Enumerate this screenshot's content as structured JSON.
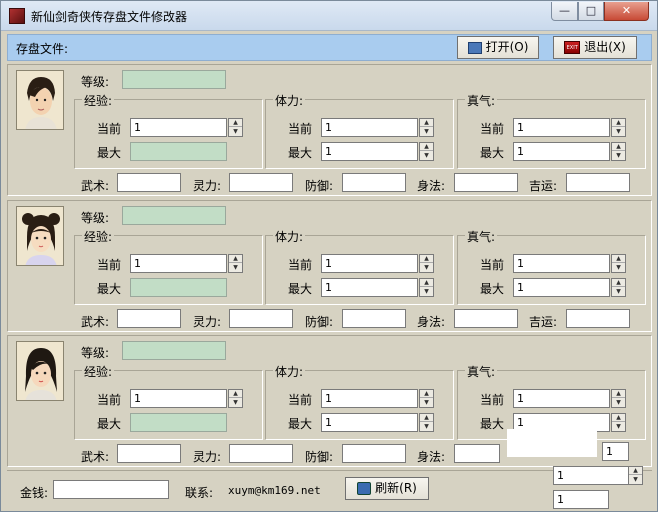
{
  "window": {
    "title": "新仙剑奇侠传存盘文件修改器",
    "controls": {
      "minimize": "—",
      "maximize": "□",
      "close": "✕"
    }
  },
  "savebar": {
    "label": "存盘文件:",
    "open_label": "打开(O)",
    "exit_label": "退出(X)",
    "exit_icon_text": "EXIT"
  },
  "labels": {
    "level": "等级:",
    "exp": "经验:",
    "hp": "体力:",
    "mp": "真气:",
    "current": "当前",
    "max": "最大",
    "wushu": "武术:",
    "lingli": "灵力:",
    "fangyu": "防御:",
    "shenfa": "身法:",
    "jiyun": "吉运:"
  },
  "characters": [
    {
      "name": "char-1",
      "level": "",
      "exp": {
        "current": "1",
        "max": ""
      },
      "hp": {
        "current": "1",
        "max": "1"
      },
      "mp": {
        "current": "1",
        "max": "1"
      },
      "stats": {
        "wushu": "",
        "lingli": "",
        "fangyu": "",
        "shenfa": "",
        "jiyun": ""
      }
    },
    {
      "name": "char-2",
      "level": "",
      "exp": {
        "current": "1",
        "max": ""
      },
      "hp": {
        "current": "1",
        "max": "1"
      },
      "mp": {
        "current": "1",
        "max": "1"
      },
      "stats": {
        "wushu": "",
        "lingli": "",
        "fangyu": "",
        "shenfa": "",
        "jiyun": ""
      }
    },
    {
      "name": "char-3",
      "level": "",
      "exp": {
        "current": "1",
        "max": ""
      },
      "hp": {
        "current": "1",
        "max": "1"
      },
      "mp": {
        "current": "1",
        "max": "1"
      },
      "stats": {
        "wushu": "",
        "lingli": "",
        "fangyu": "",
        "shenfa": ""
      }
    }
  ],
  "bottom": {
    "gold_label": "金钱:",
    "gold_value": "",
    "contact_label": "联系:",
    "contact_value": "xuym@km169.net",
    "refresh_label": "刷新(R)"
  },
  "stray_fields": [
    "1",
    "1",
    "1"
  ]
}
